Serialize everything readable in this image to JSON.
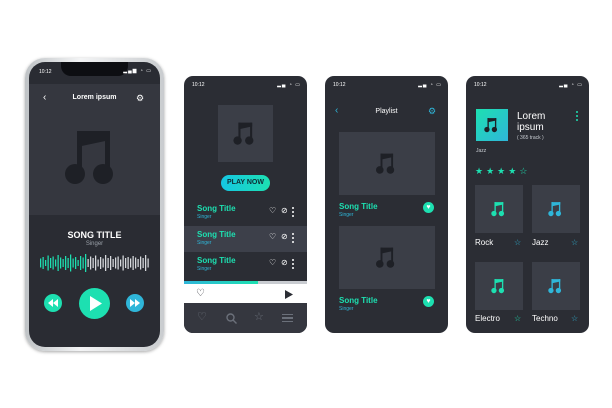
{
  "status_time": "10:12",
  "player": {
    "header_title": "Lorem ipsum",
    "song_title": "SONG TITLE",
    "singer": "Singer",
    "waveform_levels": [
      0.45,
      0.6,
      0.3,
      0.75,
      0.5,
      0.65,
      0.35,
      0.8,
      0.55,
      0.4,
      0.7,
      0.5,
      0.85,
      0.45,
      0.6,
      0.3,
      0.7,
      0.55,
      0.9,
      0.4,
      0.65,
      0.5,
      0.75,
      0.35,
      0.6,
      0.45,
      0.8,
      0.5,
      0.7,
      0.4,
      0.55,
      0.65,
      0.35,
      0.75,
      0.5,
      0.6,
      0.45,
      0.7,
      0.55,
      0.4,
      0.65,
      0.5,
      0.8,
      0.45
    ],
    "waveform_played_fraction": 0.43
  },
  "list_screen": {
    "play_now_label": "PLAY NOW",
    "songs": [
      {
        "title": "Song Title",
        "singer": "Singer"
      },
      {
        "title": "Song Title",
        "singer": "Singer"
      },
      {
        "title": "Song Title",
        "singer": "Singer"
      }
    ],
    "progress_fraction": 0.6
  },
  "playlist_screen": {
    "header_title": "Playlist",
    "items": [
      {
        "title": "Song Title",
        "singer": "Singer"
      },
      {
        "title": "Song Title",
        "singer": "Singer"
      }
    ]
  },
  "genre_screen": {
    "album_title_line1": "Lorem",
    "album_title_line2": "ipsum",
    "track_count": "( 365 track )",
    "genre": "Jazz",
    "rating": 4,
    "rating_max": 5,
    "genres": [
      {
        "label": "Rock",
        "color": "#1de0b1"
      },
      {
        "label": "Jazz",
        "color": "#2fb6d9"
      },
      {
        "label": "Electro",
        "color": "#1de0b1"
      },
      {
        "label": "Techno",
        "color": "#2fb6d9"
      }
    ]
  },
  "colors": {
    "accent_teal": "#1de0b1",
    "accent_blue": "#2fb6d9",
    "screen_bg": "#2b2d34",
    "tile_bg": "#3b3e47"
  }
}
